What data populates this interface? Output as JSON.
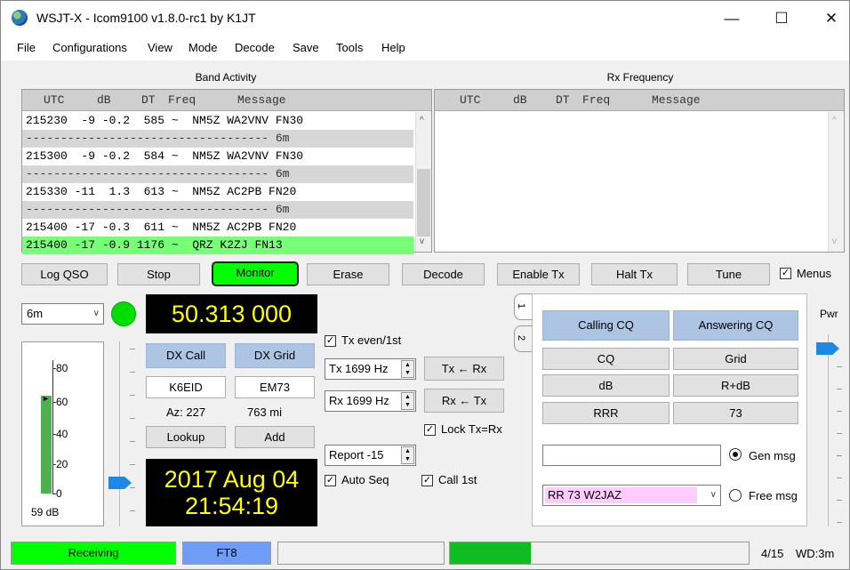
{
  "window": {
    "title": "WSJT-X - Icom9100   v1.8.0-rc1   by K1JT",
    "minimize": "—",
    "maximize": "☐",
    "close": "✕"
  },
  "menu": [
    "File",
    "Configurations",
    "View",
    "Mode",
    "Decode",
    "Save",
    "Tools",
    "Help"
  ],
  "band_activity": {
    "label": "Band Activity",
    "headers": [
      "UTC",
      "dB",
      "DT",
      "Freq",
      "Message"
    ],
    "rows": [
      {
        "text": "215230  -9 -0.2  585 ~  NM5Z WA2VNV FN30",
        "type": "normal"
      },
      {
        "text": "----------------------------------- 6m",
        "type": "sep"
      },
      {
        "text": "215300  -9 -0.2  584 ~  NM5Z WA2VNV FN30",
        "type": "normal"
      },
      {
        "text": "----------------------------------- 6m",
        "type": "sep"
      },
      {
        "text": "215330 -11  1.3  613 ~  NM5Z AC2PB FN20",
        "type": "normal"
      },
      {
        "text": "----------------------------------- 6m",
        "type": "sep"
      },
      {
        "text": "215400 -17 -0.3  611 ~  NM5Z AC2PB FN20",
        "type": "normal"
      },
      {
        "text": "215400 -17 -0.9 1176 ~  QRZ K2ZJ FN13",
        "type": "hl"
      }
    ]
  },
  "rx_frequency": {
    "label": "Rx Frequency",
    "headers": [
      "UTC",
      "dB",
      "DT",
      "Freq",
      "Message"
    ]
  },
  "controls": {
    "log_qso": "Log QSO",
    "stop": "Stop",
    "monitor": "Monitor",
    "erase": "Erase",
    "decode": "Decode",
    "enable_tx": "Enable Tx",
    "halt_tx": "Halt Tx",
    "tune": "Tune",
    "menus": "Menus",
    "menus_checked": true
  },
  "band": {
    "value": "6m"
  },
  "frequency": "50.313 000",
  "dx": {
    "call_label": "DX Call",
    "grid_label": "DX Grid",
    "call_value": "K6EID",
    "grid_value": "EM73",
    "az": "Az: 227",
    "dist": "763 mi",
    "lookup": "Lookup",
    "add": "Add"
  },
  "clock": {
    "date": "2017 Aug 04",
    "time": "21:54:19"
  },
  "tx_options": {
    "tx_even": "Tx even/1st",
    "tx_freq": "Tx  1699 Hz",
    "rx_freq": "Rx  1699 Hz",
    "tx_from_rx": "Tx ← Rx",
    "rx_from_tx": "Rx ← Tx",
    "lock": "Lock Tx=Rx",
    "report": "Report -15",
    "auto_seq": "Auto Seq",
    "call_1st": "Call 1st"
  },
  "signal_meter": {
    "level_db": 59,
    "readout": "59 dB",
    "ticks": [
      "80",
      "60",
      "40",
      "20",
      "0"
    ],
    "fill_fraction": 0.73
  },
  "msg_panel": {
    "tab1": "1",
    "tab2": "2",
    "calling_cq": "Calling CQ",
    "answering_cq": "Answering CQ",
    "cq": "CQ",
    "grid": "Grid",
    "db": "dB",
    "r_db": "R+dB",
    "rrr": "RRR",
    "seventy_three": "73",
    "gen_msg": "Gen msg",
    "free_msg": "Free msg",
    "free_msg_value": "RR 73  W2JAZ"
  },
  "pwr_label": "Pwr",
  "status": {
    "receiving": "Receiving",
    "mode": "FT8",
    "progress_fraction": 0.27,
    "count": "4/15",
    "wd": "WD:3m"
  },
  "colors": {
    "green": "#00ff00",
    "blue": "#6f9cf5",
    "highlight": "#77ff77",
    "lcd_text": "#ffff00",
    "gen_pink": "#ffccff"
  }
}
